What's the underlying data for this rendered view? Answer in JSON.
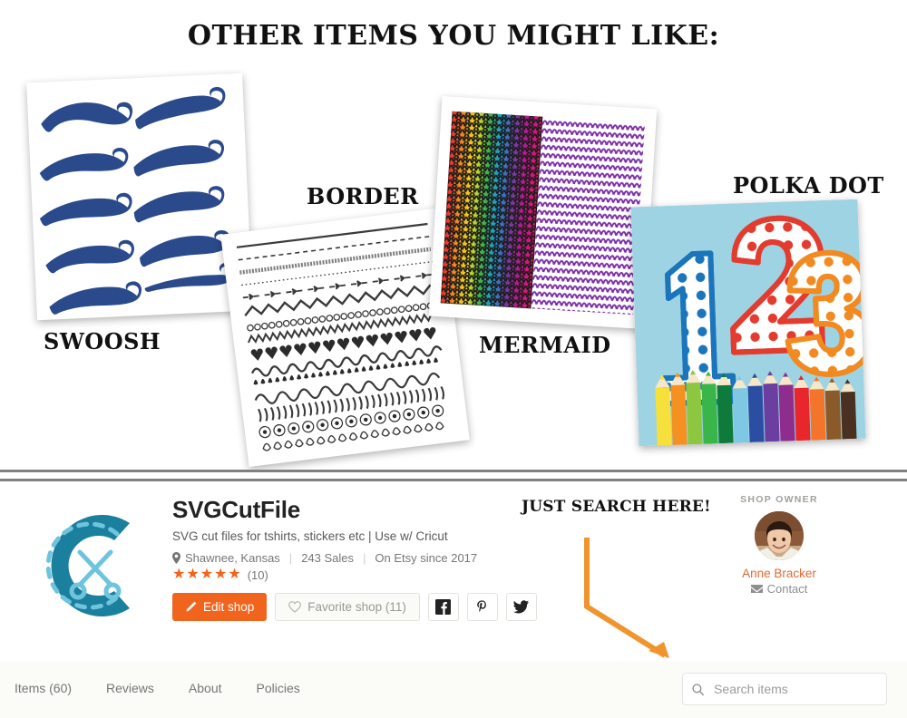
{
  "promo": {
    "title": "OTHER ITEMS YOU MIGHT LIKE:",
    "cards": [
      {
        "label": "SWOOSH",
        "theme": "navy-swoosh-set"
      },
      {
        "label": "BORDER",
        "theme": "black-border-strips"
      },
      {
        "label": "MERMAID",
        "theme": "rainbow-and-purple-scales"
      },
      {
        "label": "POLKA DOT",
        "theme": "polka-dot-numbers-123"
      }
    ]
  },
  "annotation": {
    "text": "JUST SEARCH HERE!",
    "arrow_color": "#f0942e"
  },
  "shop": {
    "logo_icon": "scissors-c-logo",
    "name": "SVGCutFile",
    "tagline": "SVG cut files for tshirts, stickers etc | Use w/ Cricut",
    "location": "Shawnee, Kansas",
    "sales": "243 Sales",
    "since": "On Etsy since 2017",
    "stars": "★★★★★",
    "rating_count": "(10)",
    "buttons": {
      "edit_label": "Edit shop",
      "favorite_label": "Favorite shop (11)",
      "facebook_label": "f",
      "pinterest_label": "p",
      "twitter_label": "t"
    },
    "accent_color": "#f1641e",
    "logo_color": "#1b7f9e"
  },
  "owner": {
    "section_label": "SHOP OWNER",
    "avatar_alt": "owner-avatar-photo",
    "name": "Anne Bracker",
    "contact_label": "Contact"
  },
  "nav": {
    "items": [
      {
        "label": "Items (60)"
      },
      {
        "label": "Reviews"
      },
      {
        "label": "About"
      },
      {
        "label": "Policies"
      }
    ],
    "search_placeholder": "Search items",
    "search_value": ""
  }
}
